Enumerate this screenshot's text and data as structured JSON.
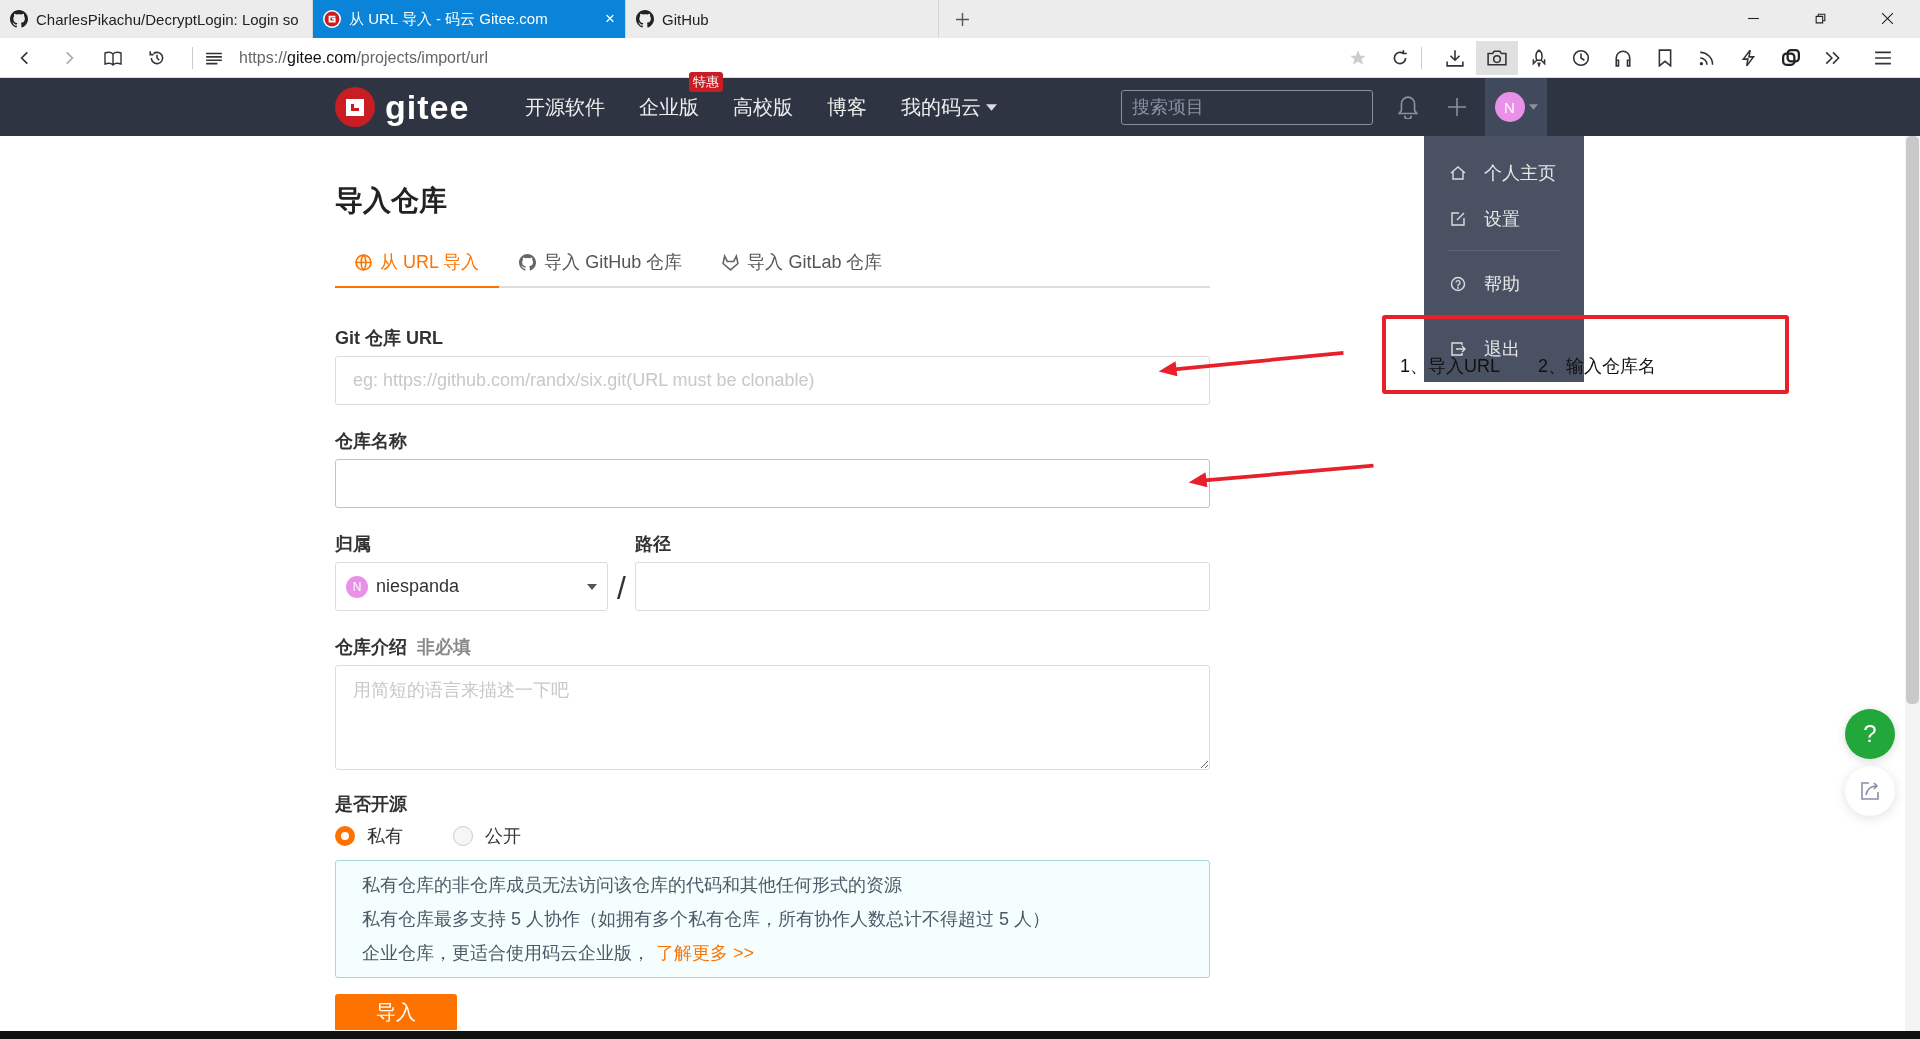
{
  "browser": {
    "tabs": [
      {
        "title": "CharlesPikachu/DecryptLogin: Login so",
        "kind": "github",
        "selected": false
      },
      {
        "title": "从 URL 导入 - 码云 Gitee.com",
        "kind": "gitee",
        "selected": true,
        "close": "×"
      },
      {
        "title": "GitHub",
        "kind": "github",
        "selected": false
      }
    ],
    "url": {
      "scheme": "https://",
      "host": "gitee.com",
      "path": "/projects/import/url"
    }
  },
  "navbar": {
    "logo": "gitee",
    "items": [
      {
        "label": "开源软件",
        "dropdown": false
      },
      {
        "label": "企业版",
        "badge": "特惠",
        "dropdown": false
      },
      {
        "label": "高校版",
        "dropdown": false
      },
      {
        "label": "博客",
        "dropdown": false
      },
      {
        "label": "我的码云",
        "dropdown": true
      }
    ],
    "search": {
      "placeholder": "搜索项目"
    },
    "avatar": "N"
  },
  "user_menu": {
    "groups": [
      [
        {
          "label": "个人主页",
          "kind": "home"
        },
        {
          "label": "设置",
          "kind": "edit"
        }
      ],
      [
        {
          "label": "帮助",
          "kind": "help"
        }
      ],
      [
        {
          "label": "退出",
          "kind": "logout"
        }
      ]
    ]
  },
  "page": {
    "title": "导入仓库",
    "tabs": [
      {
        "label": "从 URL 导入",
        "kind": "globe",
        "selected": true
      },
      {
        "label": "导入 GitHub 仓库",
        "kind": "github",
        "selected": false
      },
      {
        "label": "导入 GitLab 仓库",
        "kind": "gitlab",
        "selected": false
      }
    ],
    "git_url": {
      "label": "Git 仓库 URL",
      "placeholder": "eg: https://github.com/randx/six.git(URL must be clonable)",
      "focused": false
    },
    "repo_name": {
      "label": "仓库名称",
      "focused": true
    },
    "owner": {
      "label": "归属",
      "avatar": "N",
      "value": "niespanda"
    },
    "separator": "/",
    "path": {
      "label": "路径"
    },
    "description": {
      "label": "仓库介绍",
      "hint": "非必填",
      "placeholder": "用简短的语言来描述一下吧"
    },
    "visibility": {
      "label": "是否开源",
      "options": [
        {
          "label": "私有",
          "selected": true
        },
        {
          "label": "公开",
          "selected": false
        }
      ]
    },
    "notice": {
      "lines": [
        "私有仓库的非仓库成员无法访问该仓库的代码和其他任何形式的资源",
        "私有仓库最多支持 5 人协作（如拥有多个私有仓库，所有协作人数总计不得超过 5 人）",
        "企业仓库，更适合使用码云企业版，"
      ],
      "link": "了解更多 >>"
    },
    "submit": "导入"
  },
  "annotation": {
    "notes": [
      "1、导入URL",
      "2、输入仓库名"
    ]
  },
  "float_buttons": {
    "help": "?"
  }
}
